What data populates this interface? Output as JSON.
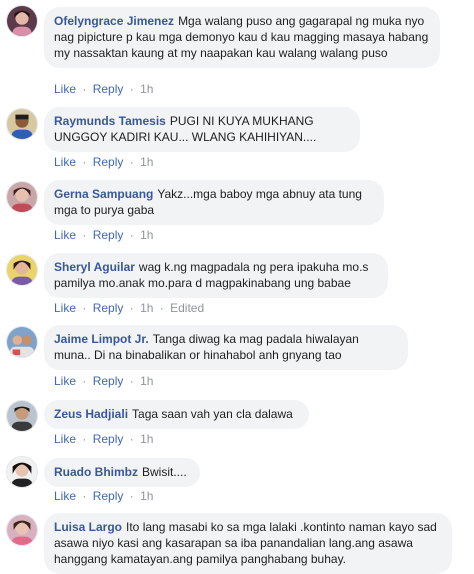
{
  "actions": {
    "like": "Like",
    "reply": "Reply",
    "separator": "·"
  },
  "comments": [
    {
      "author": "Ofelyngrace Jimenez",
      "text": "Mga walang puso ang gagarapal ng muka nyo nag pipicture p kau mga demonyo kau d kau magging masaya habang my nassaktan kaung at my naapakan kau walang walang puso",
      "time": "1h",
      "edited": ""
    },
    {
      "author": "Raymunds Tamesis",
      "text": "PUGI NI KUYA MUKHANG UNGGOY KADIRI KAU... WLANG KAHIHIYAN....",
      "time": "1h",
      "edited": ""
    },
    {
      "author": "Gerna Sampuang",
      "text": "Yakz...mga baboy mga abnuy ata tung mga to purya gaba",
      "time": "1h",
      "edited": ""
    },
    {
      "author": "Sheryl Aguilar",
      "text": "wag k.ng magpadala ng pera ipakuha mo.s pamilya mo.anak mo.para d magpakinabang ung babae",
      "time": "1h",
      "edited": "Edited"
    },
    {
      "author": "Jaime Limpot Jr.",
      "text": "Tanga diwag ka mag padala hiwalayan muna.. Di na binabalikan or hinahabol anh gnyang tao",
      "time": "1h",
      "edited": ""
    },
    {
      "author": "Zeus Hadjiali",
      "text": "Taga saan vah yan cla dalawa",
      "time": "1h",
      "edited": ""
    },
    {
      "author": "Ruado Bhimbz",
      "text": "Bwisit....",
      "time": "1h",
      "edited": ""
    },
    {
      "author": "Luisa Largo",
      "text": "Ito lang masabi ko sa mga lalaki .kontinto naman kayo sad asawa niyo kasi ang kasarapan sa iba panandalian lang.ang asawa hanggang kamatayan.ang pamilya panghabang buhay.",
      "time": "",
      "edited": ""
    }
  ]
}
